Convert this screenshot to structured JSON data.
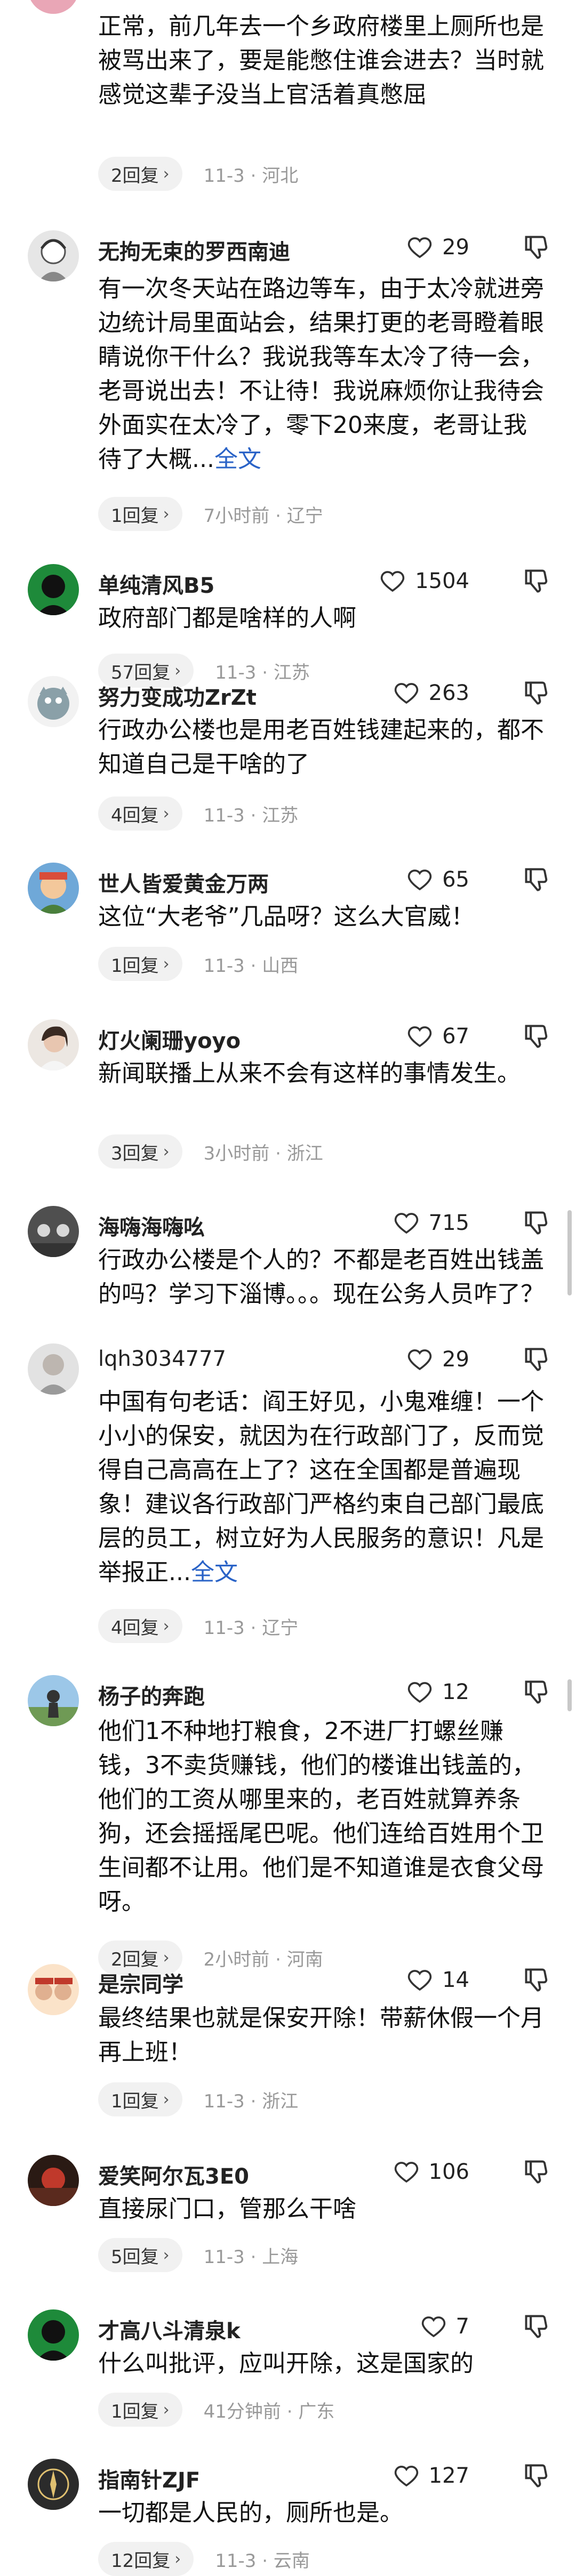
{
  "comments": [
    {
      "username": "",
      "likes": "",
      "text": "正常，前几年去一个乡政府楼里上厕所也是被骂出来了，要是能憋住谁会进去？当时就感觉这辈子没当上官活着真憋屈",
      "more": "",
      "replies": "2回复",
      "meta": "11-3 · 河北",
      "avatar_color": "#e9a6b6"
    },
    {
      "username": "无拘无束的罗西南迪",
      "likes": "29",
      "text": "有一次冬天站在路边等车，由于太冷就进旁边统计局里面站会，结果打更的老哥瞪着眼睛说你干什么？我说我等车太冷了待一会，老哥说出去！不让待！我说麻烦你让我待会外面实在太冷了，零下20来度，老哥让我待了大概...",
      "more": "全文",
      "replies": "1回复",
      "meta": "7小时前 · 辽宁",
      "avatar_color": "#bdbdbd"
    },
    {
      "username": "单纯清风B5",
      "likes": "1504",
      "text": "政府部门都是啥样的人啊",
      "more": "",
      "replies": "57回复",
      "meta": "11-3 · 江苏",
      "avatar_color": "#222222"
    },
    {
      "username": "努力变成功ZrZt",
      "likes": "263",
      "text": "行政办公楼也是用老百姓钱建起来的，都不知道自己是干啥的了",
      "more": "",
      "replies": "4回复",
      "meta": "11-3 · 江苏",
      "avatar_color": "#8aa0a8"
    },
    {
      "username": "世人皆爱黄金万两",
      "likes": "65",
      "text": "这位“大老爷”几品呀？这么大官威！",
      "more": "",
      "replies": "1回复",
      "meta": "11-3 · 山西",
      "avatar_color": "#6fa8d8"
    },
    {
      "username": "灯火阑珊yoyo",
      "likes": "67",
      "text": "新闻联播上从来不会有这样的事情发生。",
      "more": "",
      "replies": "3回复",
      "meta": "3小时前 · 浙江",
      "avatar_color": "#c9c2bc"
    },
    {
      "username": "海嗨海嗨吆",
      "likes": "715",
      "text": "行政办公楼是个人的？不都是老百姓出钱盖的吗？学习下淄博。。。现在公务人员咋了？",
      "more": "",
      "replies": "",
      "meta": "",
      "avatar_color": "#5a5a5a"
    },
    {
      "username": "lqh3034777",
      "likes": "29",
      "text": "中国有句老话：阎王好见，小鬼难缠！一个小小的保安，就因为在行政部门了，反而觉得自己高高在上了？这在全国都是普遍现象！建议各行政部门严格约束自己部门最底层的员工，树立好为人民服务的意识！凡是举报正...",
      "more": "全文",
      "replies": "4回复",
      "meta": "11-3 · 辽宁",
      "avatar_color": "#d9d9d9"
    },
    {
      "username": "杨子的奔跑",
      "likes": "12",
      "text": "他们1不种地打粮食，2不进厂打螺丝赚钱，3不卖货赚钱，他们的楼谁出钱盖的，他们的工资从哪里来的，老百姓就算养条狗，还会摇摇尾巴呢。他们连给百姓用个卫生间都不让用。他们是不知道谁是衣食父母呀。",
      "more": "",
      "replies": "2回复",
      "meta": "2小时前 · 河南",
      "avatar_color": "#7fb3d5"
    },
    {
      "username": "是宗同学",
      "likes": "14",
      "text": "最终结果也就是保安开除！带薪休假一个月再上班！",
      "more": "",
      "replies": "1回复",
      "meta": "11-3 · 浙江",
      "avatar_color": "#e0b090"
    },
    {
      "username": "爱笑阿尔瓦3E0",
      "likes": "106",
      "text": "直接尿门口，管那么干啥",
      "more": "",
      "replies": "5回复",
      "meta": "11-3 · 上海",
      "avatar_color": "#c0392b"
    },
    {
      "username": "才高八斗清泉k",
      "likes": "7",
      "text": "什么叫批评，应叫开除，这是国家的",
      "more": "",
      "replies": "1回复",
      "meta": "41分钟前 · 广东",
      "avatar_color": "#222222"
    },
    {
      "username": "指南针ZJF",
      "likes": "127",
      "text": "一切都是人民的，厕所也是。",
      "more": "",
      "replies": "12回复",
      "meta": "11-3 · 云南",
      "avatar_color": "#2b2b2b"
    }
  ]
}
